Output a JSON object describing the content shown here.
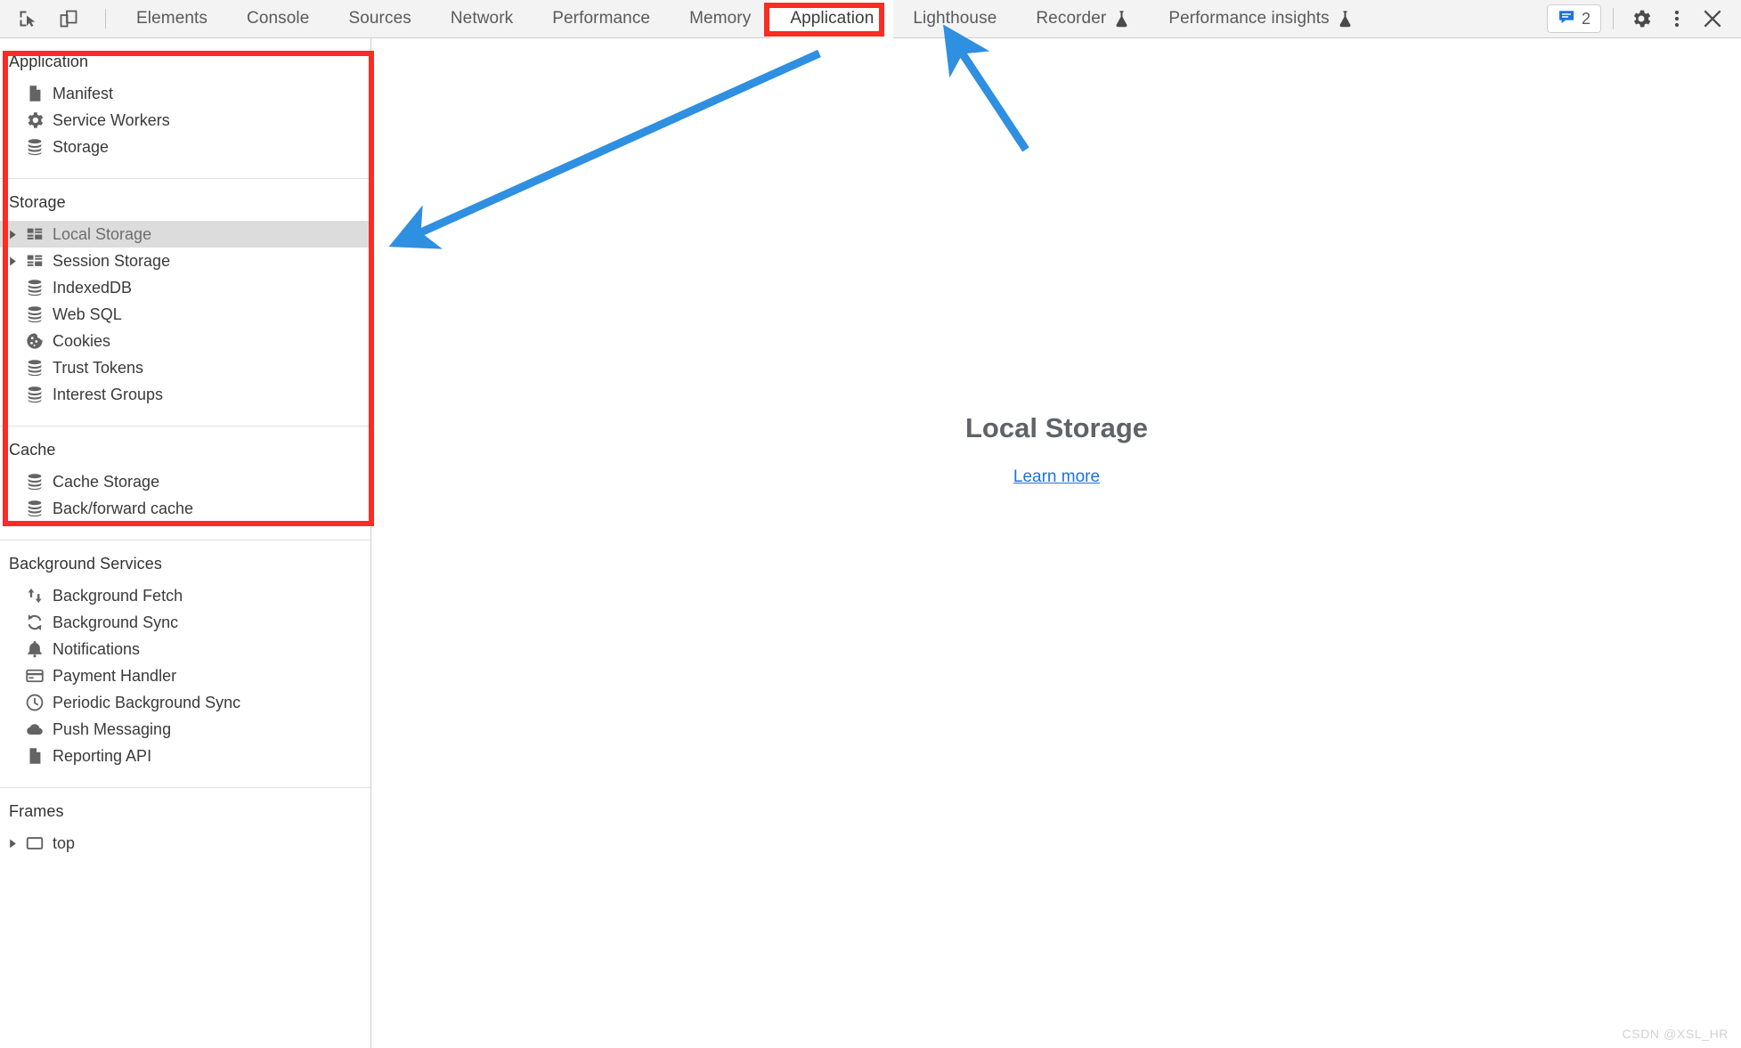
{
  "toolbar": {
    "left_icons": [
      {
        "name": "inspect-element-icon",
        "label": "Inspect element"
      },
      {
        "name": "device-toolbar-icon",
        "label": "Toggle device toolbar"
      }
    ],
    "tabs": [
      {
        "label": "Elements",
        "active": false,
        "experimental": false
      },
      {
        "label": "Console",
        "active": false,
        "experimental": false
      },
      {
        "label": "Sources",
        "active": false,
        "experimental": false
      },
      {
        "label": "Network",
        "active": false,
        "experimental": false
      },
      {
        "label": "Performance",
        "active": false,
        "experimental": false
      },
      {
        "label": "Memory",
        "active": false,
        "experimental": false
      },
      {
        "label": "Application",
        "active": true,
        "experimental": false
      },
      {
        "label": "Lighthouse",
        "active": false,
        "experimental": false
      },
      {
        "label": "Recorder",
        "active": false,
        "experimental": true
      },
      {
        "label": "Performance insights",
        "active": false,
        "experimental": true
      }
    ],
    "issues": {
      "icon": "issues-message-icon",
      "count": "2"
    },
    "settings_label": "Settings",
    "more_label": "Customize and control DevTools",
    "close_label": "Close DevTools"
  },
  "sidebar": {
    "sections": [
      {
        "title": "Application",
        "items": [
          {
            "label": "Manifest",
            "icon": "document-icon",
            "expandable": false,
            "selected": false
          },
          {
            "label": "Service Workers",
            "icon": "gear-icon",
            "expandable": false,
            "selected": false
          },
          {
            "label": "Storage",
            "icon": "database-icon",
            "expandable": false,
            "selected": false
          }
        ]
      },
      {
        "title": "Storage",
        "items": [
          {
            "label": "Local Storage",
            "icon": "table-icon",
            "expandable": true,
            "selected": true
          },
          {
            "label": "Session Storage",
            "icon": "table-icon",
            "expandable": true,
            "selected": false
          },
          {
            "label": "IndexedDB",
            "icon": "database-icon",
            "expandable": false,
            "selected": false
          },
          {
            "label": "Web SQL",
            "icon": "database-icon",
            "expandable": false,
            "selected": false
          },
          {
            "label": "Cookies",
            "icon": "cookie-icon",
            "expandable": false,
            "selected": false
          },
          {
            "label": "Trust Tokens",
            "icon": "database-icon",
            "expandable": false,
            "selected": false
          },
          {
            "label": "Interest Groups",
            "icon": "database-icon",
            "expandable": false,
            "selected": false
          }
        ]
      },
      {
        "title": "Cache",
        "items": [
          {
            "label": "Cache Storage",
            "icon": "database-icon",
            "expandable": false,
            "selected": false
          },
          {
            "label": "Back/forward cache",
            "icon": "database-icon",
            "expandable": false,
            "selected": false
          }
        ]
      },
      {
        "title": "Background Services",
        "items": [
          {
            "label": "Background Fetch",
            "icon": "updown-arrows-icon",
            "expandable": false,
            "selected": false
          },
          {
            "label": "Background Sync",
            "icon": "sync-icon",
            "expandable": false,
            "selected": false
          },
          {
            "label": "Notifications",
            "icon": "bell-icon",
            "expandable": false,
            "selected": false
          },
          {
            "label": "Payment Handler",
            "icon": "credit-card-icon",
            "expandable": false,
            "selected": false
          },
          {
            "label": "Periodic Background Sync",
            "icon": "clock-icon",
            "expandable": false,
            "selected": false
          },
          {
            "label": "Push Messaging",
            "icon": "cloud-icon",
            "expandable": false,
            "selected": false
          },
          {
            "label": "Reporting API",
            "icon": "document-icon",
            "expandable": false,
            "selected": false
          }
        ]
      },
      {
        "title": "Frames",
        "items": [
          {
            "label": "top",
            "icon": "frame-icon",
            "expandable": true,
            "selected": false
          }
        ]
      }
    ]
  },
  "main": {
    "title": "Local Storage",
    "link": "Learn more"
  },
  "watermark": "CSDN @XSL_HR",
  "colors": {
    "annotation_red": "#fb2c24",
    "annotation_blue": "#2f8fe0",
    "link_blue": "#1a73e8",
    "selection_gray": "#dcdcdc",
    "toolbar_bg": "#f3f3f3"
  }
}
